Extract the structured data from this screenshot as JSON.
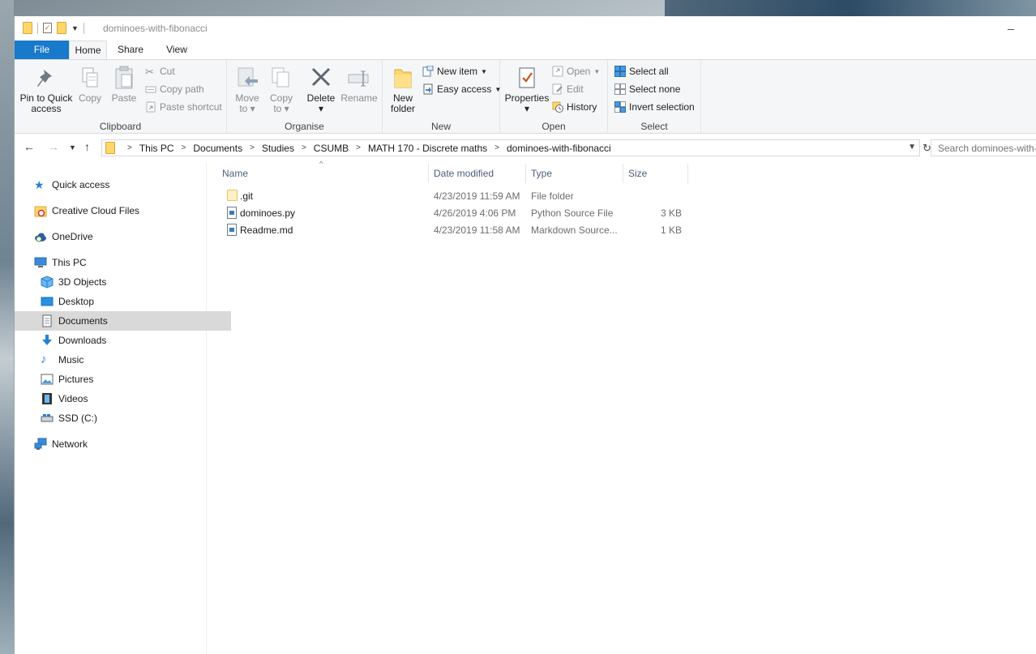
{
  "window": {
    "title": "dominoes-with-fibonacci"
  },
  "tabs": {
    "file": "File",
    "home": "Home",
    "share": "Share",
    "view": "View"
  },
  "ribbon": {
    "clipboard": {
      "label": "Clipboard",
      "pin_line1": "Pin to Quick",
      "pin_line2": "access",
      "copy": "Copy",
      "paste": "Paste",
      "cut": "Cut",
      "copy_path": "Copy path",
      "paste_shortcut": "Paste shortcut"
    },
    "organise": {
      "label": "Organise",
      "move_line1": "Move",
      "move_line2": "to",
      "copy_line1": "Copy",
      "copy_line2": "to",
      "delete": "Delete",
      "rename": "Rename"
    },
    "new": {
      "label": "New",
      "folder_line1": "New",
      "folder_line2": "folder",
      "new_item": "New item",
      "easy_access": "Easy access"
    },
    "open": {
      "label": "Open",
      "properties": "Properties",
      "open": "Open",
      "edit": "Edit",
      "history": "History"
    },
    "select": {
      "label": "Select",
      "select_all": "Select all",
      "select_none": "Select none",
      "invert": "Invert selection"
    }
  },
  "address": {
    "crumbs": [
      "This PC",
      "Documents",
      "Studies",
      "CSUMB",
      "MATH 170 - Discrete maths",
      "dominoes-with-fibonacci"
    ],
    "search_placeholder": "Search dominoes-with-fibonacci"
  },
  "navpane": {
    "quick_access": "Quick access",
    "creative_cloud": "Creative Cloud Files",
    "onedrive": "OneDrive",
    "this_pc": "This PC",
    "objects3d": "3D Objects",
    "desktop": "Desktop",
    "documents": "Documents",
    "downloads": "Downloads",
    "music": "Music",
    "pictures": "Pictures",
    "videos": "Videos",
    "ssd": "SSD (C:)",
    "network": "Network"
  },
  "columns": {
    "name": "Name",
    "date": "Date modified",
    "type": "Type",
    "size": "Size"
  },
  "files": [
    {
      "name": ".git",
      "date": "4/23/2019 11:59 AM",
      "type": "File folder",
      "size": ""
    },
    {
      "name": "dominoes.py",
      "date": "4/26/2019 4:06 PM",
      "type": "Python Source File",
      "size": "3 KB"
    },
    {
      "name": "Readme.md",
      "date": "4/23/2019 11:58 AM",
      "type": "Markdown Source...",
      "size": "1 KB"
    }
  ],
  "colors": {
    "file_tab": "#1979ca",
    "selected": "#d9d9d9",
    "column_header": "#4c607a",
    "folder": "#ffd66b"
  }
}
